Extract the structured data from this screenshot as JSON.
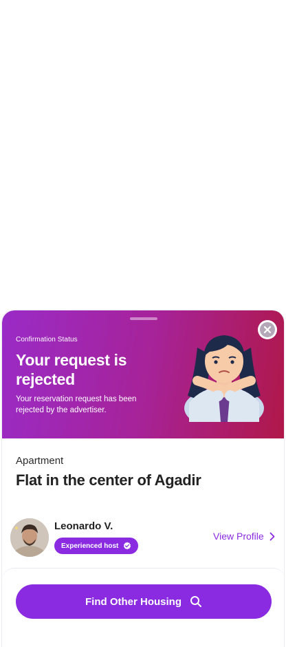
{
  "confirmation": {
    "status_label": "Confirmation Status",
    "headline": "Your request is rejected",
    "description": "Your reservation request has been rejected by the advertiser."
  },
  "listing": {
    "category": "Apartment",
    "title": "Flat in the center of Agadir"
  },
  "host": {
    "name": "Leonardo V.",
    "badge": "Experienced host",
    "view_profile_label": "View Profile"
  },
  "actions": {
    "find_housing_label": "Find Other Housing"
  },
  "colors": {
    "accent": "#8a2be2",
    "banner_start": "#9a2bc7",
    "banner_end": "#b01848"
  },
  "icons": [
    "close-icon",
    "chevron-right-icon",
    "verified-check-icon",
    "search-icon"
  ]
}
